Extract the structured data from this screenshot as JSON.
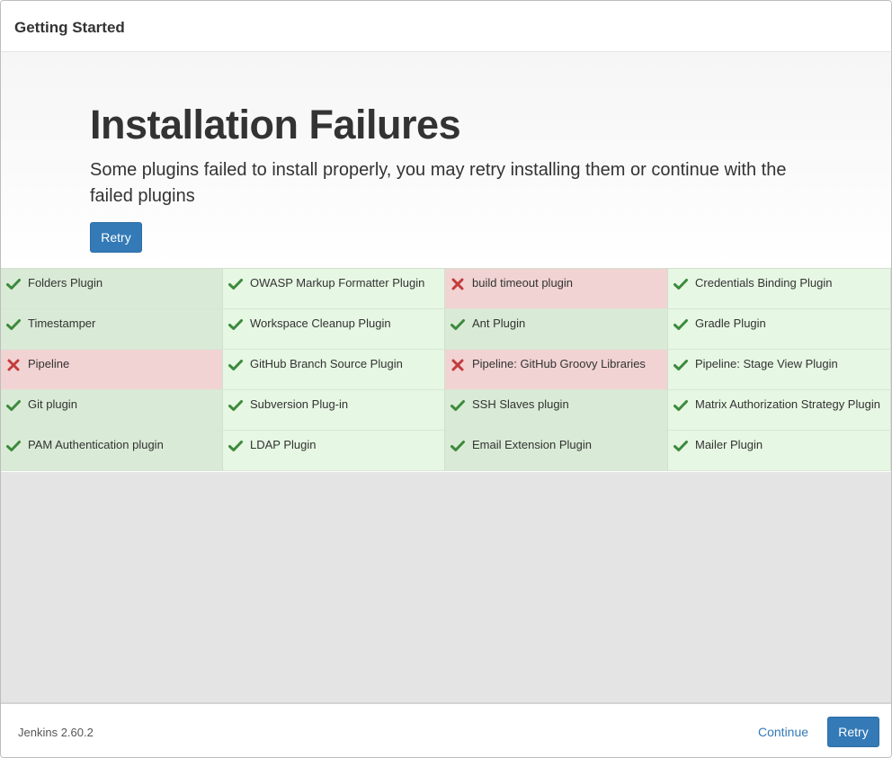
{
  "header": {
    "title": "Getting Started"
  },
  "hero": {
    "title": "Installation Failures",
    "subtitle": "Some plugins failed to install properly, you may retry installing them or continue with the failed plugins",
    "retry_label": "Retry"
  },
  "plugins": [
    {
      "label": "Folders Plugin",
      "status": "success",
      "shade": "dark"
    },
    {
      "label": "OWASP Markup Formatter Plugin",
      "status": "success",
      "shade": "light"
    },
    {
      "label": "build timeout plugin",
      "status": "failed",
      "shade": "fail"
    },
    {
      "label": "Credentials Binding Plugin",
      "status": "success",
      "shade": "light"
    },
    {
      "label": "Timestamper",
      "status": "success",
      "shade": "dark"
    },
    {
      "label": "Workspace Cleanup Plugin",
      "status": "success",
      "shade": "light"
    },
    {
      "label": "Ant Plugin",
      "status": "success",
      "shade": "dark"
    },
    {
      "label": "Gradle Plugin",
      "status": "success",
      "shade": "light"
    },
    {
      "label": "Pipeline",
      "status": "failed",
      "shade": "fail"
    },
    {
      "label": "GitHub Branch Source Plugin",
      "status": "success",
      "shade": "light"
    },
    {
      "label": "Pipeline: GitHub Groovy Libraries",
      "status": "failed",
      "shade": "fail"
    },
    {
      "label": "Pipeline: Stage View Plugin",
      "status": "success",
      "shade": "light"
    },
    {
      "label": "Git plugin",
      "status": "success",
      "shade": "dark"
    },
    {
      "label": "Subversion Plug-in",
      "status": "success",
      "shade": "light"
    },
    {
      "label": "SSH Slaves plugin",
      "status": "success",
      "shade": "dark"
    },
    {
      "label": "Matrix Authorization Strategy Plugin",
      "status": "success",
      "shade": "light"
    },
    {
      "label": "PAM Authentication plugin",
      "status": "success",
      "shade": "dark"
    },
    {
      "label": "LDAP Plugin",
      "status": "success",
      "shade": "light"
    },
    {
      "label": "Email Extension Plugin",
      "status": "success",
      "shade": "dark"
    },
    {
      "label": "Mailer Plugin",
      "status": "success",
      "shade": "light"
    }
  ],
  "footer": {
    "version": "Jenkins 2.60.2",
    "continue_label": "Continue",
    "retry_label": "Retry"
  },
  "colors": {
    "accent": "#337ab7",
    "success_icon": "#3c8a3c",
    "failure_icon": "#c33c3c",
    "success_bg_dark": "#d9ebd6",
    "success_bg_light": "#e6f7e3",
    "failure_bg": "#f1d3d3"
  },
  "icons": {
    "success": "checkmark-icon",
    "failure": "cross-icon"
  }
}
